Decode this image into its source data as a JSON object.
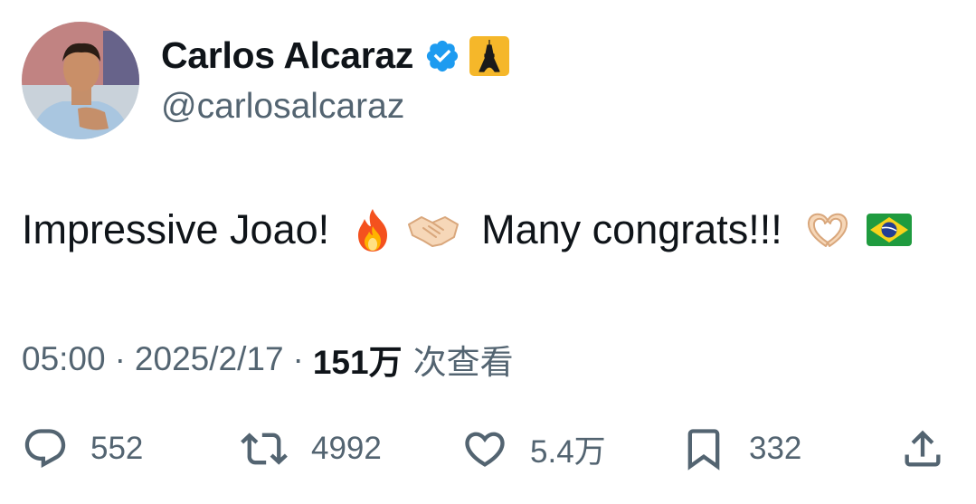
{
  "author": {
    "name": "Carlos Alcaraz",
    "handle": "@carlosalcaraz",
    "verified_icon": "verified-badge-icon",
    "badge_icon": "eiffel-tower-icon"
  },
  "tweet": {
    "text_part1": "Impressive Joao!",
    "emoji1": "fire-emoji",
    "emoji2": "handshake-emoji",
    "text_part2": "Many congrats!!!",
    "emoji3": "heart-hands-emoji",
    "emoji4": "brazil-flag-emoji"
  },
  "meta": {
    "time": "05:00",
    "separator": "·",
    "date": "2025/2/17",
    "views": "151万",
    "views_label": "次查看"
  },
  "actions": {
    "replies": "552",
    "retweets": "4992",
    "likes": "5.4万",
    "bookmarks": "332"
  },
  "colors": {
    "text": "#0f1419",
    "secondary": "#536471",
    "verified": "#1d9bf0"
  }
}
